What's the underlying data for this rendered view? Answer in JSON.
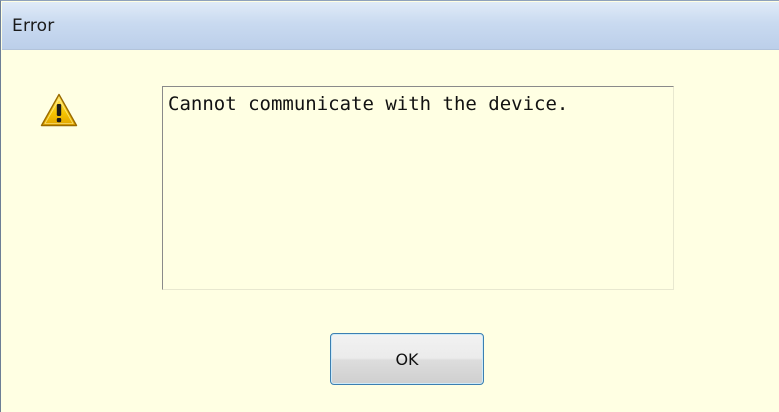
{
  "window": {
    "title": "Error"
  },
  "dialog": {
    "icon": "warning-icon",
    "message": "Cannot communicate with the device.",
    "ok_label": "OK"
  },
  "colors": {
    "background": "#ffffe3",
    "titlebar": "#c9daf0",
    "button_border": "#3c7fb1",
    "warning_fill": "#f5c400"
  }
}
